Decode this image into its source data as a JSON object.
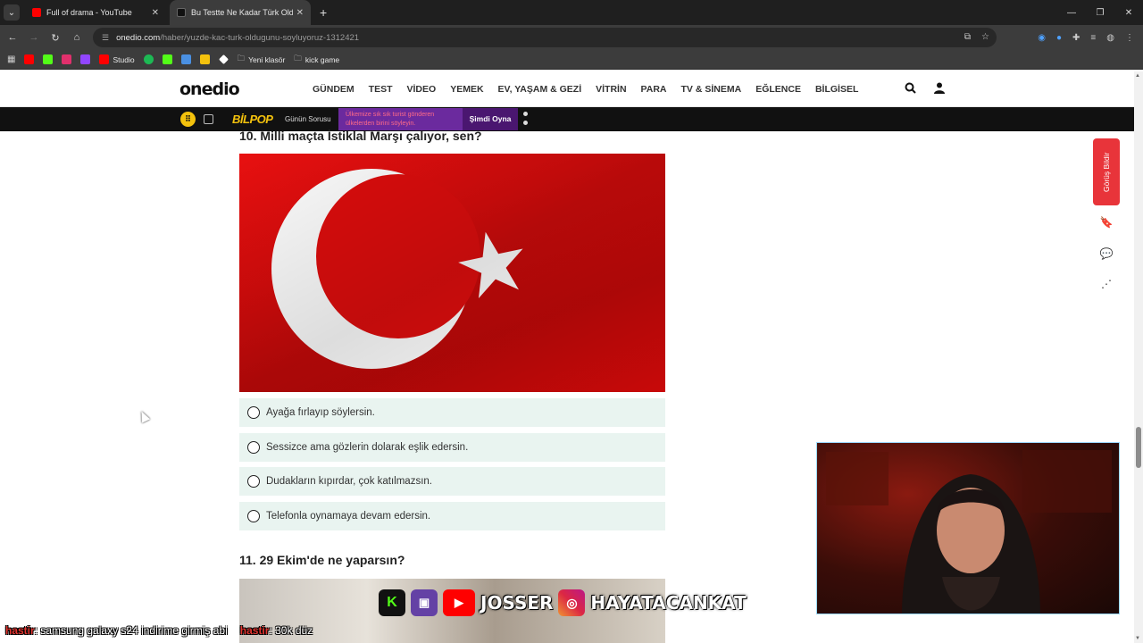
{
  "browser": {
    "tabs": [
      {
        "title": "Full of drama - YouTube",
        "favicon_color": "#ff0000"
      },
      {
        "title": "Bu Testte Ne Kadar Türk Olduğ",
        "favicon_color": "#111111"
      }
    ],
    "url_host": "onedio.com",
    "url_path": "/haber/yuzde-kac-turk-oldugunu-soyluyoruz-1312421",
    "bookmarks": [
      {
        "label": "",
        "color": "#ff0000"
      },
      {
        "label": "",
        "color": "#53fc18"
      },
      {
        "label": "",
        "color": "#e1306c"
      },
      {
        "label": "",
        "color": "#9146ff"
      },
      {
        "label": "Studio",
        "color": "#ff0000"
      },
      {
        "label": "",
        "color": "#1db954"
      },
      {
        "label": "",
        "color": "#53fc18"
      },
      {
        "label": "",
        "color": "#4a90e2"
      },
      {
        "label": "",
        "color": "#f4c20d"
      },
      {
        "label": "",
        "color": "#ffffff"
      },
      {
        "label": "Yeni klasör",
        "color": "#cccccc"
      },
      {
        "label": "kick game",
        "color": "#cccccc"
      }
    ]
  },
  "site": {
    "logo": "onedio",
    "nav": [
      "GÜNDEM",
      "TEST",
      "VİDEO",
      "YEMEK",
      "EV, YAŞAM & GEZİ",
      "VİTRİN",
      "PARA",
      "TV & SİNEMA",
      "EĞLENCE",
      "BİLGİSEL"
    ]
  },
  "promo": {
    "brand": "BİLPOP",
    "label": "Günün Sorusu",
    "question": "Ülkemize sık sık turist gönderen ülkelerden birini söyleyin.",
    "cta": "Şimdi Oyna"
  },
  "quiz": {
    "q10_title": "10. Milli maçta İstiklal Marşı çalıyor, sen?",
    "q10_options": [
      "Ayağa fırlayıp söylersin.",
      "Sessizce ama gözlerin dolarak eşlik edersin.",
      "Dudakların kıpırdar, çok katılmazsın.",
      "Telefonla oynamaya devam edersin."
    ],
    "q11_title": "11. 29 Ekim'de ne yaparsın?"
  },
  "sidebar": {
    "feedback": "Görüş Bildir"
  },
  "stream_overlay": {
    "name": "JOSSER",
    "instagram": "HAYATACANKAT"
  },
  "chat": [
    {
      "user": "hastir",
      "message": ": samsung galaxy s24 indirime girmiş abi"
    },
    {
      "user": "hastir",
      "message": ": 30k düz"
    }
  ]
}
